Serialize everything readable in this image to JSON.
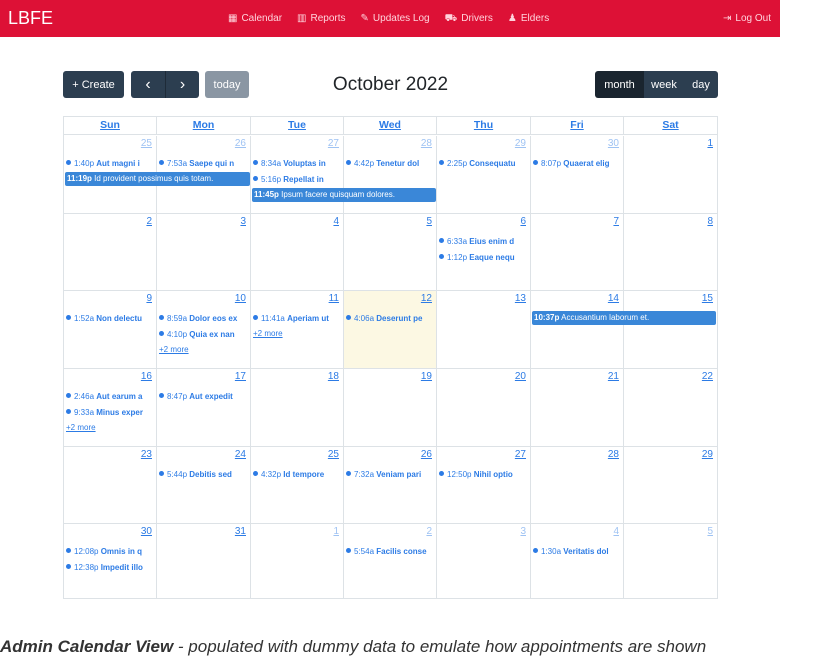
{
  "navbar": {
    "brand": "LBFE",
    "links": [
      {
        "label": "Calendar",
        "icon": "calendar-icon",
        "glyph": "▦"
      },
      {
        "label": "Reports",
        "icon": "chart-icon",
        "glyph": "▥"
      },
      {
        "label": "Updates Log",
        "icon": "edit-icon",
        "glyph": "✎"
      },
      {
        "label": "Drivers",
        "icon": "car-icon",
        "glyph": "⛟"
      },
      {
        "label": "Elders",
        "icon": "user-icon",
        "glyph": "♟"
      }
    ],
    "logout": {
      "label": "Log Out",
      "icon": "sign-out-icon",
      "glyph": "⇥"
    }
  },
  "toolbar": {
    "create": "+ Create",
    "prev": "‹",
    "next": "›",
    "today": "today",
    "title": "October 2022",
    "views": [
      "month",
      "week",
      "day"
    ],
    "active_view": "month"
  },
  "colors": {
    "brand": "#dd1136",
    "accent": "#2c7be5",
    "bar": "#3a87d8",
    "today_bg": "#fcf8e3",
    "button": "#2c3e50"
  },
  "calendar": {
    "dow": [
      "Sun",
      "Mon",
      "Tue",
      "Wed",
      "Thu",
      "Fri",
      "Sat"
    ],
    "weeks": [
      {
        "days": [
          {
            "n": "25",
            "o": true
          },
          {
            "n": "26",
            "o": true
          },
          {
            "n": "27",
            "o": true
          },
          {
            "n": "28",
            "o": true
          },
          {
            "n": "29",
            "o": true
          },
          {
            "n": "30",
            "o": true
          },
          {
            "n": "1",
            "o": false
          }
        ],
        "events": [
          {
            "col": 0,
            "slot": 0,
            "time": "1:40p",
            "title": "Aut magni i"
          },
          {
            "col": 1,
            "slot": 0,
            "time": "7:53a",
            "title": "Saepe qui n"
          },
          {
            "col": 2,
            "slot": 0,
            "time": "8:34a",
            "title": "Voluptas in"
          },
          {
            "col": 3,
            "slot": 0,
            "time": "4:42p",
            "title": "Tenetur dol"
          },
          {
            "col": 4,
            "slot": 0,
            "time": "2:25p",
            "title": "Consequatu"
          },
          {
            "col": 5,
            "slot": 0,
            "time": "8:07p",
            "title": "Quaerat elig"
          },
          {
            "col": 2,
            "slot": 1,
            "time": "5:16p",
            "title": "Repellat in"
          }
        ],
        "bars": [
          {
            "start": 0,
            "span": 2,
            "slot": 1,
            "time": "11:19p",
            "title": "Id provident possimus quis totam."
          },
          {
            "start": 2,
            "span": 2,
            "slot": 2,
            "time": "11:45p",
            "title": "Ipsum facere quisquam dolores."
          }
        ],
        "more": []
      },
      {
        "days": [
          {
            "n": "2",
            "o": false
          },
          {
            "n": "3",
            "o": false
          },
          {
            "n": "4",
            "o": false
          },
          {
            "n": "5",
            "o": false
          },
          {
            "n": "6",
            "o": false
          },
          {
            "n": "7",
            "o": false
          },
          {
            "n": "8",
            "o": false
          }
        ],
        "events": [
          {
            "col": 4,
            "slot": 0,
            "time": "6:33a",
            "title": "Eius enim d"
          },
          {
            "col": 4,
            "slot": 1,
            "time": "1:12p",
            "title": "Eaque nequ"
          }
        ],
        "bars": [],
        "more": []
      },
      {
        "days": [
          {
            "n": "9",
            "o": false
          },
          {
            "n": "10",
            "o": false
          },
          {
            "n": "11",
            "o": false
          },
          {
            "n": "12",
            "o": false,
            "today": true
          },
          {
            "n": "13",
            "o": false
          },
          {
            "n": "14",
            "o": false
          },
          {
            "n": "15",
            "o": false
          }
        ],
        "events": [
          {
            "col": 0,
            "slot": 0,
            "time": "1:52a",
            "title": "Non delectu"
          },
          {
            "col": 1,
            "slot": 0,
            "time": "8:59a",
            "title": "Dolor eos ex"
          },
          {
            "col": 2,
            "slot": 0,
            "time": "11:41a",
            "title": "Aperiam ut"
          },
          {
            "col": 3,
            "slot": 0,
            "time": "4:06a",
            "title": "Deserunt pe"
          },
          {
            "col": 1,
            "slot": 1,
            "time": "4:10p",
            "title": "Quia ex nan"
          }
        ],
        "bars": [
          {
            "start": 5,
            "span": 2,
            "slot": 0,
            "time": "10:37p",
            "title": "Accusantium laborum et."
          }
        ],
        "more": [
          {
            "col": 2,
            "slot": 1,
            "label": "+2 more"
          },
          {
            "col": 1,
            "slot": 2,
            "label": "+2 more"
          }
        ]
      },
      {
        "days": [
          {
            "n": "16",
            "o": false
          },
          {
            "n": "17",
            "o": false
          },
          {
            "n": "18",
            "o": false
          },
          {
            "n": "19",
            "o": false
          },
          {
            "n": "20",
            "o": false
          },
          {
            "n": "21",
            "o": false
          },
          {
            "n": "22",
            "o": false
          }
        ],
        "events": [
          {
            "col": 0,
            "slot": 0,
            "time": "2:46a",
            "title": "Aut earum a"
          },
          {
            "col": 1,
            "slot": 0,
            "time": "8:47p",
            "title": "Aut expedit"
          },
          {
            "col": 0,
            "slot": 1,
            "time": "9:33a",
            "title": "Minus exper"
          }
        ],
        "bars": [],
        "more": [
          {
            "col": 0,
            "slot": 2,
            "label": "+2 more"
          }
        ]
      },
      {
        "days": [
          {
            "n": "23",
            "o": false
          },
          {
            "n": "24",
            "o": false
          },
          {
            "n": "25",
            "o": false
          },
          {
            "n": "26",
            "o": false
          },
          {
            "n": "27",
            "o": false
          },
          {
            "n": "28",
            "o": false
          },
          {
            "n": "29",
            "o": false
          }
        ],
        "events": [
          {
            "col": 1,
            "slot": 0,
            "time": "5:44p",
            "title": "Debitis sed"
          },
          {
            "col": 2,
            "slot": 0,
            "time": "4:32p",
            "title": "Id tempore"
          },
          {
            "col": 3,
            "slot": 0,
            "time": "7:32a",
            "title": "Veniam pari"
          },
          {
            "col": 4,
            "slot": 0,
            "time": "12:50p",
            "title": "Nihil optio"
          }
        ],
        "bars": [],
        "more": []
      },
      {
        "days": [
          {
            "n": "30",
            "o": false
          },
          {
            "n": "31",
            "o": false
          },
          {
            "n": "1",
            "o": true
          },
          {
            "n": "2",
            "o": true
          },
          {
            "n": "3",
            "o": true
          },
          {
            "n": "4",
            "o": true
          },
          {
            "n": "5",
            "o": true
          }
        ],
        "events": [
          {
            "col": 0,
            "slot": 0,
            "time": "12:08p",
            "title": "Omnis in q"
          },
          {
            "col": 3,
            "slot": 0,
            "time": "5:54a",
            "title": "Facilis conse"
          },
          {
            "col": 5,
            "slot": 0,
            "time": "1:30a",
            "title": "Veritatis dol"
          },
          {
            "col": 0,
            "slot": 1,
            "time": "12:38p",
            "title": "Impedit illo"
          }
        ],
        "bars": [],
        "more": []
      }
    ]
  },
  "caption": {
    "bold": "Admin Calendar View",
    "rest": " - populated with dummy data to emulate how appointments are shown"
  }
}
